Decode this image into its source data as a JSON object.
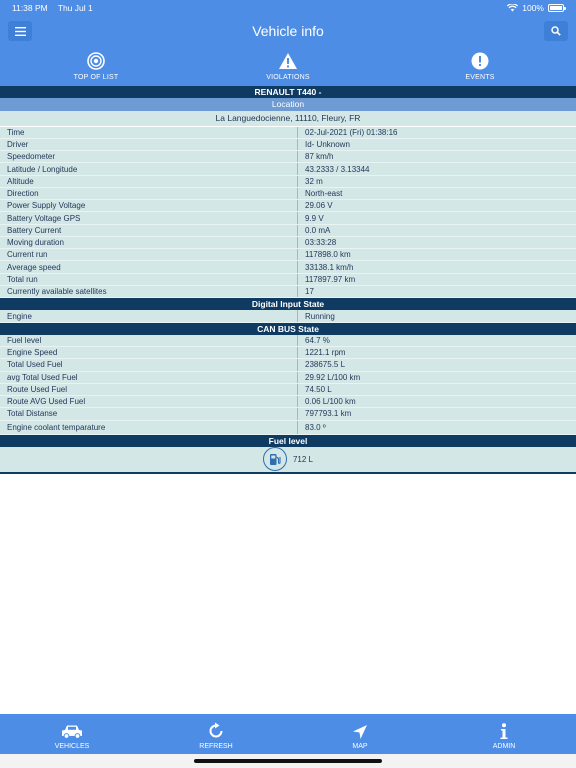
{
  "status": {
    "time": "11:38 PM",
    "date": "Thu Jul 1",
    "battery": "100%"
  },
  "nav": {
    "title": "Vehicle info"
  },
  "toolbar": [
    {
      "label": "TOP OF LIST",
      "icon": "target-icon"
    },
    {
      "label": "VIOLATIONS",
      "icon": "warning-icon"
    },
    {
      "label": "EVENTS",
      "icon": "exclamation-circle-icon"
    }
  ],
  "vehicle": {
    "name": "RENAULT T440 -"
  },
  "location": {
    "header": "Location",
    "address": "La Languedocienne, 11110, Fleury, FR"
  },
  "details": [
    {
      "label": "Time",
      "value": "02-Jul-2021 (Fri) 01:38:16"
    },
    {
      "label": "Driver",
      "value": "Id- Unknown"
    },
    {
      "label": "Speedometer",
      "value": "87 km/h"
    },
    {
      "label": "Latitude / Longitude",
      "value": "43.2333  / 3.13344"
    },
    {
      "label": "Altitude",
      "value": "32 m"
    },
    {
      "label": "Direction",
      "value": "North-east"
    },
    {
      "label": "Power Supply Voltage",
      "value": "29.06  V"
    },
    {
      "label": "Battery Voltage GPS",
      "value": "9.9  V"
    },
    {
      "label": "Battery Current",
      "value": "0.0  mA"
    },
    {
      "label": "Moving duration",
      "value": "03:33:28"
    },
    {
      "label": "Current run",
      "value": "117898.0 km"
    },
    {
      "label": "Average speed",
      "value": "33138.1 km/h"
    },
    {
      "label": "Total run",
      "value": "117897.97 km"
    },
    {
      "label": "Currently available satellites",
      "value": "17"
    }
  ],
  "digital_input": {
    "header": "Digital Input State",
    "rows": [
      {
        "label": "Engine",
        "value": "Running"
      }
    ]
  },
  "canbus": {
    "header": "CAN BUS State",
    "rows": [
      {
        "label": "Fuel level",
        "value": "64.7  %"
      },
      {
        "label": "Engine Speed",
        "value": "1221.1  rpm"
      },
      {
        "label": "Total Used Fuel",
        "value": "238675.5  L"
      },
      {
        "label": "avg Total Used Fuel",
        "value": "29.92  L/100 km"
      },
      {
        "label": "Route Used Fuel",
        "value": "74.50 L"
      },
      {
        "label": "Route AVG Used Fuel",
        "value": "0.06 L/100 km"
      },
      {
        "label": "Total Distanse",
        "value": "797793.1 km"
      },
      {
        "label": "Engine coolant temparature",
        "value": "83.0 º"
      }
    ]
  },
  "fuel": {
    "header": "Fuel level",
    "value": "712 L"
  },
  "tabs": [
    {
      "label": "VEHICLES",
      "icon": "car-icon"
    },
    {
      "label": "REFRESH",
      "icon": "refresh-icon"
    },
    {
      "label": "MAP",
      "icon": "navigation-arrow-icon"
    },
    {
      "label": "ADMIN",
      "icon": "info-icon"
    }
  ]
}
